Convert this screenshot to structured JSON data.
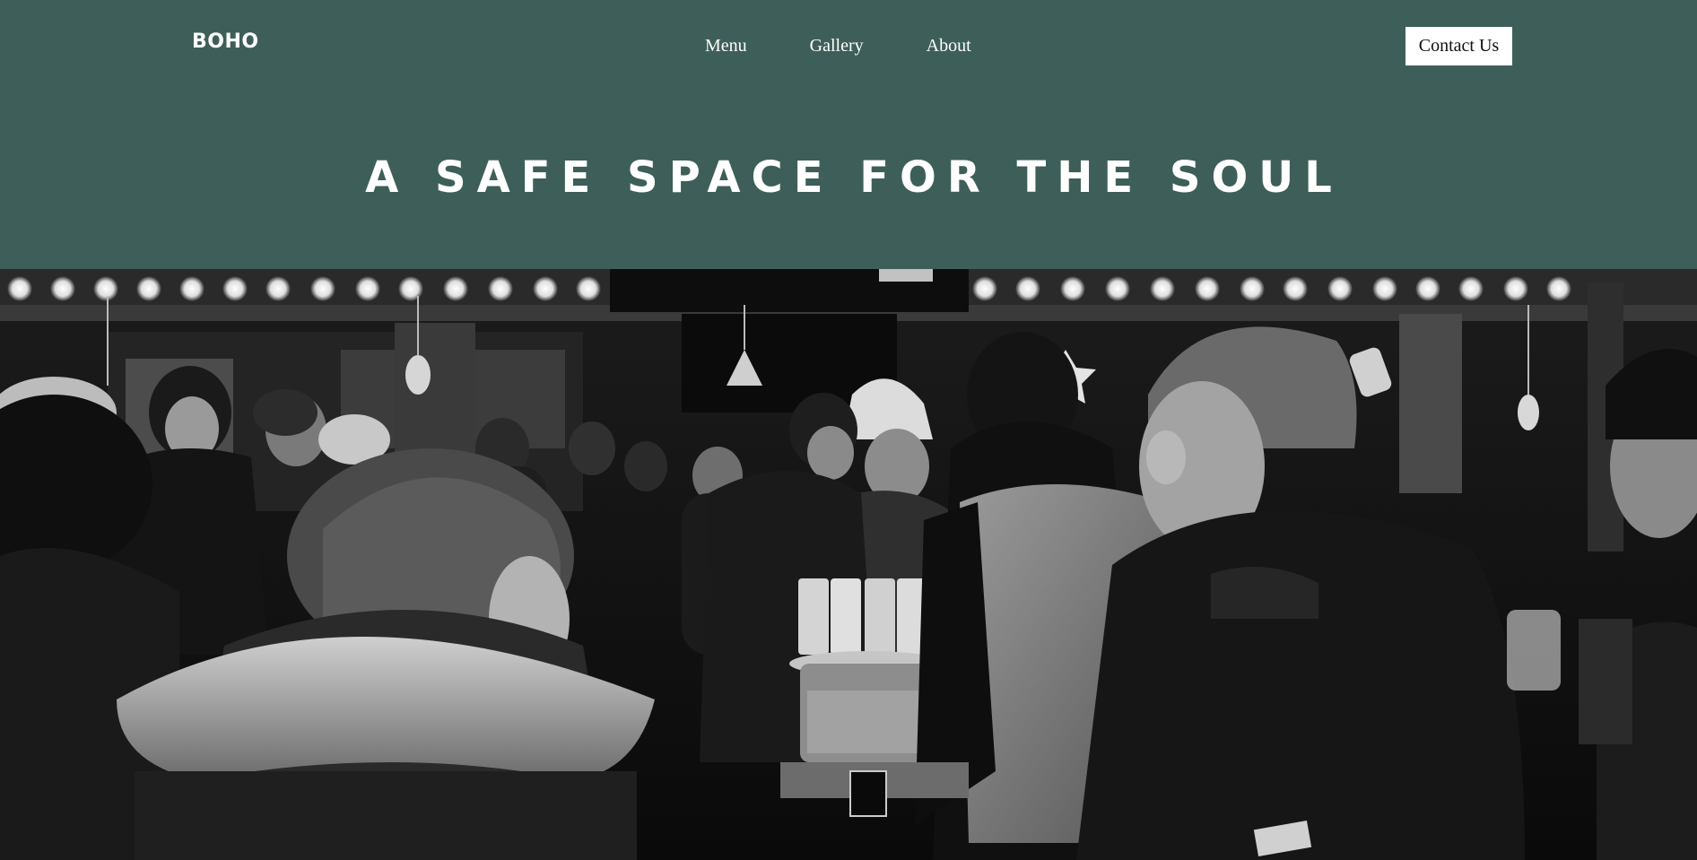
{
  "brand": {
    "logo_text": "BOHO"
  },
  "nav": {
    "items": [
      {
        "label": "Menu"
      },
      {
        "label": "Gallery"
      },
      {
        "label": "About"
      }
    ]
  },
  "header": {
    "contact_label": "Contact Us"
  },
  "hero": {
    "title": "A SAFE SPACE FOR THE SOUL",
    "image_description_icon": "photo-image"
  },
  "colors": {
    "header_bg": "#3e5f59",
    "text": "#ffffff",
    "button_bg": "#ffffff",
    "button_text": "#111111"
  }
}
